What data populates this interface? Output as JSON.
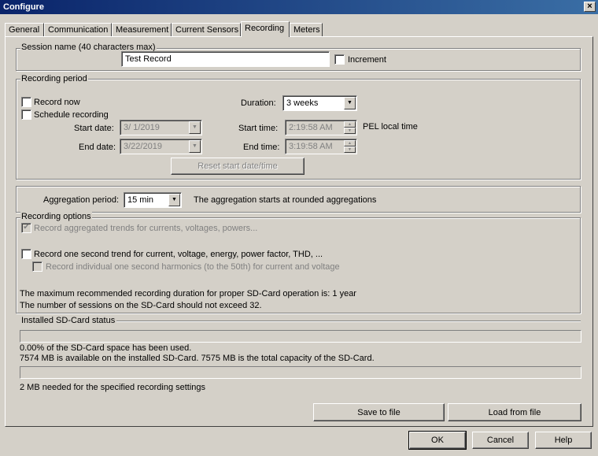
{
  "window": {
    "title": "Configure",
    "close_glyph": "×"
  },
  "tabs": [
    {
      "label": "General",
      "active": false
    },
    {
      "label": "Communication",
      "active": false
    },
    {
      "label": "Measurement",
      "active": false
    },
    {
      "label": "Current Sensors",
      "active": false
    },
    {
      "label": "Recording",
      "active": true
    },
    {
      "label": "Meters",
      "active": false
    }
  ],
  "session": {
    "legend": "Session name (40 characters max)",
    "name_value": "Test Record",
    "increment_label": "Increment",
    "increment_checked": false
  },
  "period": {
    "legend": "Recording period",
    "record_now_label": "Record now",
    "record_now_checked": false,
    "schedule_label": "Schedule recording",
    "schedule_checked": false,
    "duration_label": "Duration:",
    "duration_value": "3 weeks",
    "start_date_label": "Start date:",
    "start_date_value": "3/  1/2019",
    "end_date_label": "End date:",
    "end_date_value": "3/22/2019",
    "start_time_label": "Start time:",
    "start_time_value": "2:19:58 AM",
    "end_time_label": "End time:",
    "end_time_value": "3:19:58 AM",
    "pel_local_time": "PEL local time",
    "reset_button": "Reset start date/time"
  },
  "aggregation": {
    "label": "Aggregation period:",
    "value": "15 min",
    "note": "The aggregation starts at rounded aggregations"
  },
  "options": {
    "legend": "Recording options",
    "aggregated_trends_label": "Record aggregated trends for currents, voltages, powers...",
    "aggregated_trends_checked": true,
    "one_second_label": "Record one second trend for current, voltage, energy, power factor, THD, ...",
    "one_second_checked": false,
    "harmonics_label": "Record individual one second harmonics (to the 50th) for current and voltage",
    "harmonics_checked": false,
    "max_duration_text": "The maximum recommended recording duration for proper SD-Card operation is: 1 year",
    "sessions_text": "The number of sessions on the SD-Card should not exceed 32."
  },
  "sdcard": {
    "legend": "Installed SD-Card status",
    "used_percent": 0.0,
    "used_text": "0.00% of the SD-Card space has been used.",
    "available_text": "7574 MB is available on the installed SD-Card. 7575 MB is the total capacity of the SD-Card.",
    "needed_percent": 0.0,
    "needed_text": "2 MB needed for the specified recording settings"
  },
  "file_buttons": {
    "save": "Save to file",
    "load": "Load from file"
  },
  "dialog_buttons": {
    "ok": "OK",
    "cancel": "Cancel",
    "help": "Help"
  },
  "check_glyph": "✔",
  "down_arrow_glyph": "▼",
  "up_small_glyph": "▲",
  "down_small_glyph": "▼"
}
